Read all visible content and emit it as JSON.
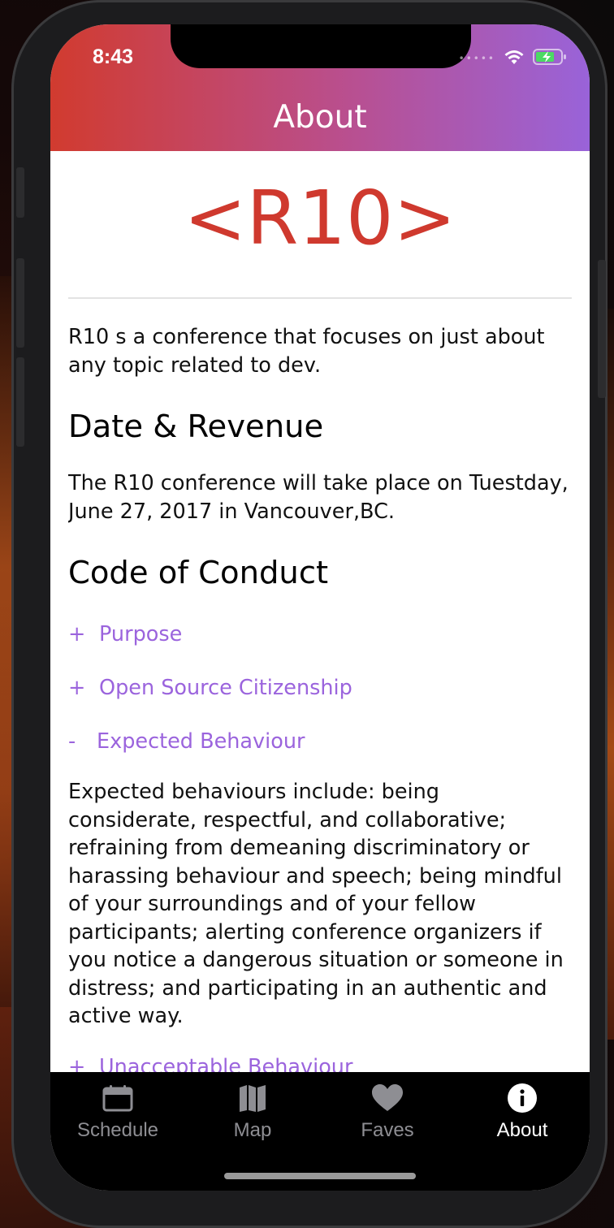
{
  "status_bar": {
    "time": "8:43",
    "signal_dots": "•••••"
  },
  "header": {
    "title": "About"
  },
  "logo": {
    "text": "<R10>"
  },
  "intro": "R10 s a conference that focuses on just about any topic related to dev.",
  "date_section": {
    "heading": "Date & Revenue",
    "body": "The R10 conference will take place on Tuestday, June 27, 2017 in Vancouver,BC."
  },
  "conduct": {
    "heading": "Code of Conduct",
    "items": [
      {
        "sign": "+",
        "label": "Purpose"
      },
      {
        "sign": "+",
        "label": "Open Source Citizenship"
      },
      {
        "sign": "-",
        "label": "Expected Behaviour",
        "body": "Expected behaviours include: being considerate, respectful, and collaborative; refraining from demeaning discriminatory or harassing behaviour and speech; being mindful of your surroundings and of your fellow participants; alerting conference organizers if you notice a dangerous situation or someone in distress; and participating in an authentic and active way."
      },
      {
        "sign": "+",
        "label": "Unacceptable Behaviour"
      }
    ]
  },
  "tabs": [
    {
      "label": "Schedule",
      "icon": "calendar-icon",
      "active": false
    },
    {
      "label": "Map",
      "icon": "map-icon",
      "active": false
    },
    {
      "label": "Faves",
      "icon": "heart-icon",
      "active": false
    },
    {
      "label": "About",
      "icon": "info-icon",
      "active": true
    }
  ],
  "colors": {
    "brand_red": "#cf392e",
    "accent_purple": "#9b64dd",
    "header_start": "#d13b2f",
    "header_end": "#9963d9"
  }
}
